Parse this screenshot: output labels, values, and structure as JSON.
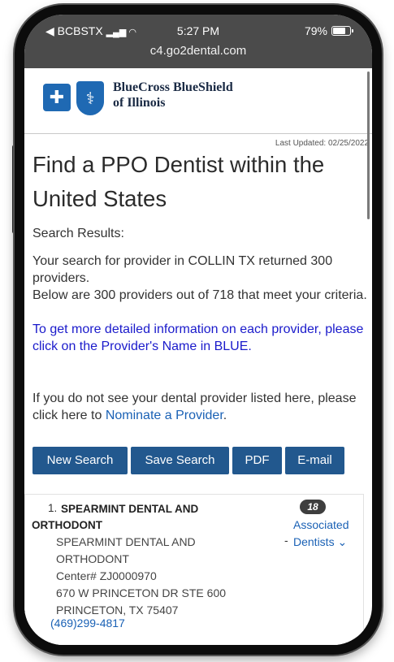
{
  "status_bar": {
    "carrier": "◀ BCBSTX",
    "time": "5:27 PM",
    "battery": "79%"
  },
  "browser": {
    "url": "c4.go2dental.com"
  },
  "brand": {
    "line1": "BlueCross BlueShield",
    "line2": "of Illinois"
  },
  "page": {
    "last_updated": "Last Updated: 02/25/2022",
    "title": "Find a PPO Dentist within the United States",
    "results_label": "Search Results:",
    "summary_1": "Your search for provider in COLLIN TX returned 300 providers.",
    "summary_2": "Below are 300 providers out of 718 that meet your criteria.",
    "info_blue": "To get more detailed information on each provider, please click on the Provider's Name in BLUE.",
    "nominate_prefix": "If you do not see your dental provider listed here, please click here to ",
    "nominate_link": "Nominate a Provider",
    "nominate_suffix": "."
  },
  "buttons": {
    "new_search": "New Search",
    "save_search": "Save Search",
    "pdf": "PDF",
    "email": "E-mail"
  },
  "provider": {
    "number": "1.",
    "name": "SPEARMINT DENTAL AND ORTHODONT",
    "associated_count": "18",
    "associated_line1": "Associated",
    "associated_line2": "Dentists ⌄",
    "dash": "-",
    "addr_line1": "SPEARMINT DENTAL AND",
    "addr_line2": "ORTHODONT",
    "center": "Center# ZJ0000970",
    "street": "670 W PRINCETON DR STE 600",
    "city": "PRINCETON, TX 75407",
    "phone": "(469)299-4817"
  },
  "colors": {
    "button_bg": "#22588e",
    "link": "#1a61b5",
    "info_text": "#1a1acb",
    "brand_blue": "#1f69b3"
  }
}
